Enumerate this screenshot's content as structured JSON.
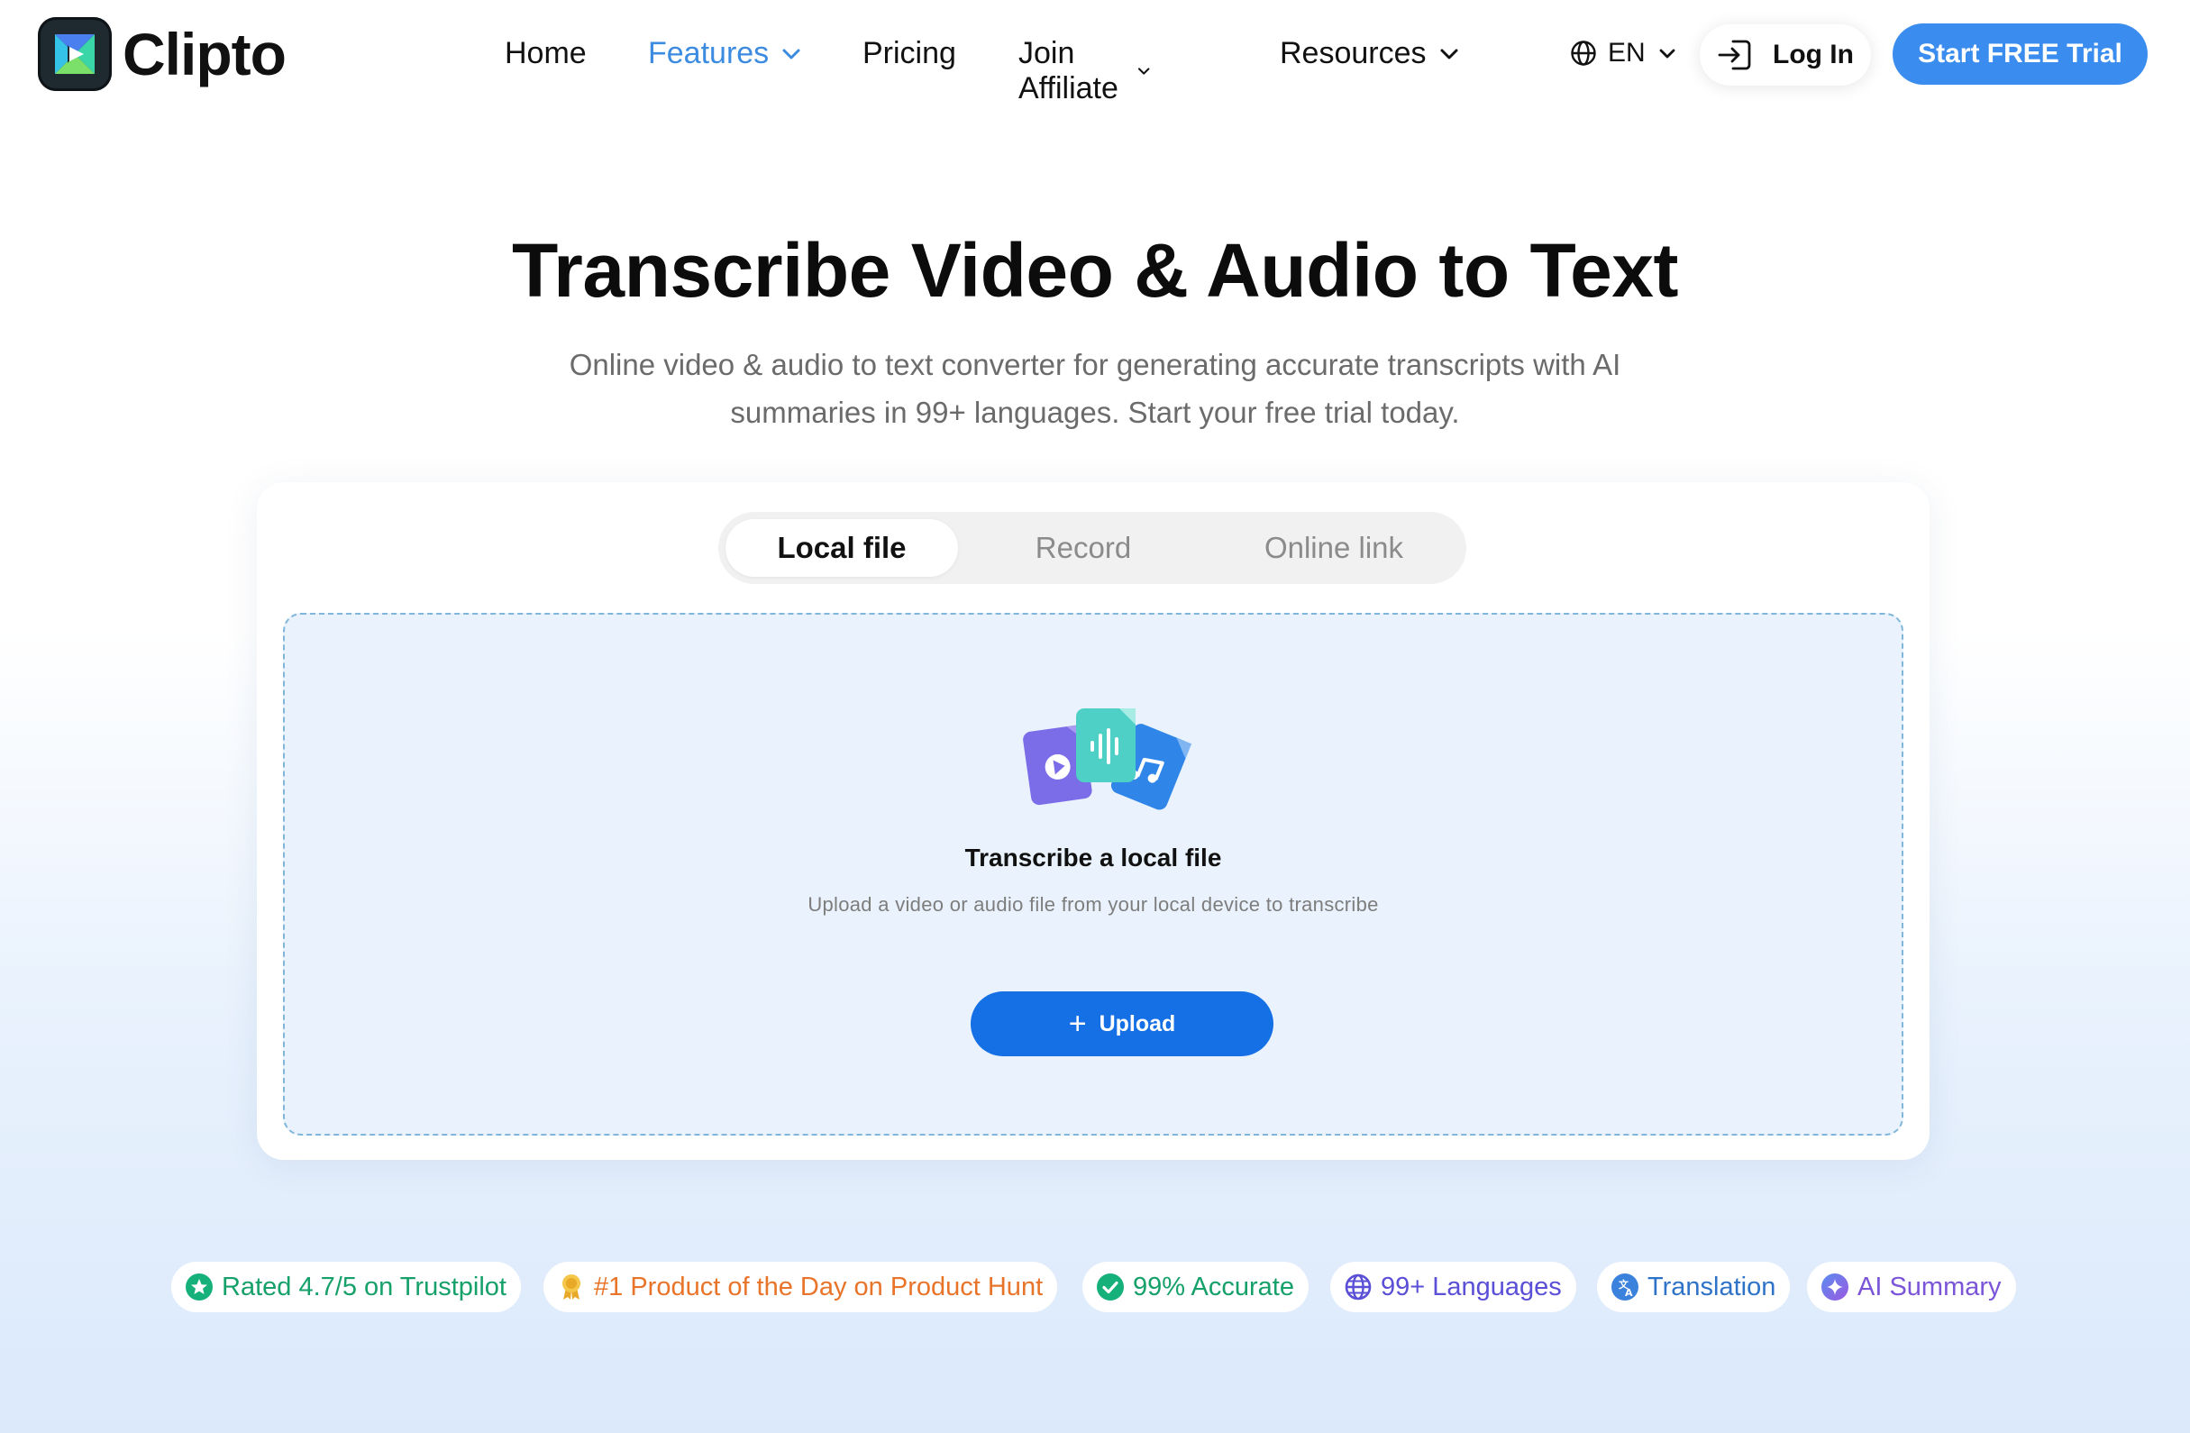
{
  "brand": {
    "name": "Clipto"
  },
  "nav": {
    "items": [
      {
        "label": "Home",
        "active": false,
        "dropdown": false
      },
      {
        "label": "Features",
        "active": true,
        "dropdown": true
      },
      {
        "label": "Pricing",
        "active": false,
        "dropdown": false
      },
      {
        "label": "Join Affiliate",
        "active": false,
        "dropdown": true
      },
      {
        "label": "Resources",
        "active": false,
        "dropdown": true
      }
    ],
    "language": "EN",
    "login_label": "Log In",
    "trial_label": "Start FREE Trial"
  },
  "hero": {
    "title": "Transcribe Video & Audio to Text",
    "subtitle_line1": "Online video & audio to text converter for generating accurate transcripts with AI",
    "subtitle_line2": "summaries in 99+ languages. Start your free trial today."
  },
  "uploader": {
    "tabs": [
      {
        "label": "Local file",
        "active": true
      },
      {
        "label": "Record",
        "active": false
      },
      {
        "label": "Online link",
        "active": false
      }
    ],
    "title": "Transcribe a local file",
    "subtitle": "Upload a video or audio file from your local device to transcribe",
    "upload_label": "Upload"
  },
  "badges": [
    {
      "label": "Rated 4.7/5 on Trustpilot",
      "color": "#16a06a",
      "icon": "star-icon"
    },
    {
      "label": "#1 Product of the Day on Product Hunt",
      "color": "#e8742a",
      "icon": "award-icon"
    },
    {
      "label": "99% Accurate",
      "color": "#16a06a",
      "icon": "check-icon"
    },
    {
      "label": "99+ Languages",
      "color": "#5a4fd6",
      "icon": "globe-icon"
    },
    {
      "label": "Translation",
      "color": "#2f73c9",
      "icon": "translate-icon"
    },
    {
      "label": "AI Summary",
      "color": "#7b55d8",
      "icon": "sparkle-icon"
    }
  ],
  "colors": {
    "accent": "#3a8dee",
    "upload": "#1570e6",
    "active_nav": "#3b8be0"
  }
}
